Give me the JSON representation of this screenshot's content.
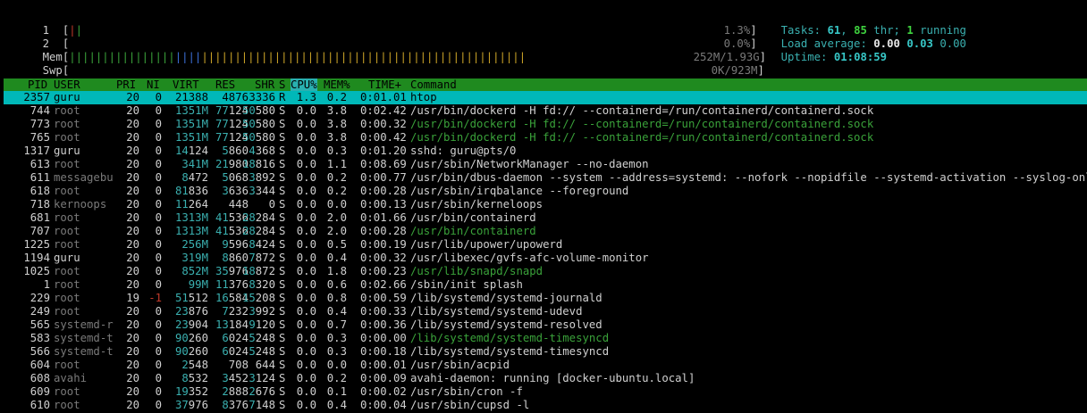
{
  "meters": {
    "cpu1": {
      "label": "1",
      "percent": "1.3%"
    },
    "cpu2": {
      "label": "2",
      "percent": "0.0%"
    },
    "mem": {
      "label": "Mem",
      "value": "252M/1.93G"
    },
    "swp": {
      "label": "Swp",
      "value": "0K/923M"
    }
  },
  "summary": {
    "tasks_label": "Tasks:",
    "tasks": "61",
    "threads": "85",
    "thr_label": "thr;",
    "running": "1",
    "running_label": "running",
    "load_label": "Load average:",
    "load1": "0.00",
    "load5": "0.03",
    "load15": "0.00",
    "uptime_label": "Uptime:",
    "uptime": "01:08:59"
  },
  "columns": [
    "PID",
    "USER",
    "PRI",
    "NI",
    "VIRT",
    "RES",
    "SHR",
    "S",
    "CPU%",
    "MEM%",
    "TIME+",
    "Command"
  ],
  "processes": [
    {
      "pid": "2357",
      "user": "guru",
      "pri": "20",
      "ni": "0",
      "virt": "21388",
      "res": "4876",
      "shr": "3336",
      "s": "R",
      "cpu": "1.3",
      "mem": "0.2",
      "time": "0:01.01",
      "cmd": "htop",
      "selected": true
    },
    {
      "pid": "744",
      "user": "root",
      "pri": "20",
      "ni": "0",
      "virt": "1351M",
      "res": "77124",
      "shr": "50580",
      "s": "S",
      "cpu": "0.0",
      "mem": "3.8",
      "time": "0:02.42",
      "cmd": "/usr/bin/dockerd -H fd:// --containerd=/run/containerd/containerd.sock"
    },
    {
      "pid": "773",
      "user": "root",
      "pri": "20",
      "ni": "0",
      "virt": "1351M",
      "res": "77124",
      "shr": "50580",
      "s": "S",
      "cpu": "0.0",
      "mem": "3.8",
      "time": "0:00.32",
      "cmd": "/usr/bin/dockerd -H fd:// --containerd=/run/containerd/containerd.sock",
      "thread": true
    },
    {
      "pid": "765",
      "user": "root",
      "pri": "20",
      "ni": "0",
      "virt": "1351M",
      "res": "77124",
      "shr": "50580",
      "s": "S",
      "cpu": "0.0",
      "mem": "3.8",
      "time": "0:00.42",
      "cmd": "/usr/bin/dockerd -H fd:// --containerd=/run/containerd/containerd.sock",
      "thread": true
    },
    {
      "pid": "1317",
      "user": "guru",
      "pri": "20",
      "ni": "0",
      "virt": "14124",
      "res": "5860",
      "shr": "4368",
      "s": "S",
      "cpu": "0.0",
      "mem": "0.3",
      "time": "0:01.20",
      "cmd": "sshd: guru@pts/0"
    },
    {
      "pid": "613",
      "user": "root",
      "pri": "20",
      "ni": "0",
      "virt": "341M",
      "res": "21980",
      "shr": "18816",
      "s": "S",
      "cpu": "0.0",
      "mem": "1.1",
      "time": "0:08.69",
      "cmd": "/usr/sbin/NetworkManager --no-daemon"
    },
    {
      "pid": "611",
      "user": "messagebu",
      "pri": "20",
      "ni": "0",
      "virt": "8472",
      "res": "5068",
      "shr": "3892",
      "s": "S",
      "cpu": "0.0",
      "mem": "0.2",
      "time": "0:00.77",
      "cmd": "/usr/bin/dbus-daemon --system --address=systemd: --nofork --nopidfile --systemd-activation --syslog-only"
    },
    {
      "pid": "618",
      "user": "root",
      "pri": "20",
      "ni": "0",
      "virt": "81836",
      "res": "3636",
      "shr": "3344",
      "s": "S",
      "cpu": "0.0",
      "mem": "0.2",
      "time": "0:00.28",
      "cmd": "/usr/sbin/irqbalance --foreground"
    },
    {
      "pid": "718",
      "user": "kernoops",
      "pri": "20",
      "ni": "0",
      "virt": "11264",
      "res": "448",
      "shr": "0",
      "s": "S",
      "cpu": "0.0",
      "mem": "0.0",
      "time": "0:00.13",
      "cmd": "/usr/sbin/kerneloops"
    },
    {
      "pid": "681",
      "user": "root",
      "pri": "20",
      "ni": "0",
      "virt": "1313M",
      "res": "41536",
      "shr": "28284",
      "s": "S",
      "cpu": "0.0",
      "mem": "2.0",
      "time": "0:01.66",
      "cmd": "/usr/bin/containerd"
    },
    {
      "pid": "707",
      "user": "root",
      "pri": "20",
      "ni": "0",
      "virt": "1313M",
      "res": "41536",
      "shr": "28284",
      "s": "S",
      "cpu": "0.0",
      "mem": "2.0",
      "time": "0:00.28",
      "cmd": "/usr/bin/containerd",
      "thread": true
    },
    {
      "pid": "1225",
      "user": "root",
      "pri": "20",
      "ni": "0",
      "virt": "256M",
      "res": "9596",
      "shr": "8424",
      "s": "S",
      "cpu": "0.0",
      "mem": "0.5",
      "time": "0:00.19",
      "cmd": "/usr/lib/upower/upowerd"
    },
    {
      "pid": "1194",
      "user": "guru",
      "pri": "20",
      "ni": "0",
      "virt": "319M",
      "res": "8860",
      "shr": "7872",
      "s": "S",
      "cpu": "0.0",
      "mem": "0.4",
      "time": "0:00.32",
      "cmd": "/usr/libexec/gvfs-afc-volume-monitor"
    },
    {
      "pid": "1025",
      "user": "root",
      "pri": "20",
      "ni": "0",
      "virt": "852M",
      "res": "35976",
      "shr": "18872",
      "s": "S",
      "cpu": "0.0",
      "mem": "1.8",
      "time": "0:00.23",
      "cmd": "/usr/lib/snapd/snapd",
      "thread": true
    },
    {
      "pid": "1",
      "user": "root",
      "pri": "20",
      "ni": "0",
      "virt": "99M",
      "res": "11376",
      "shr": "8320",
      "s": "S",
      "cpu": "0.0",
      "mem": "0.6",
      "time": "0:02.66",
      "cmd": "/sbin/init splash"
    },
    {
      "pid": "229",
      "user": "root",
      "pri": "19",
      "ni": "-1",
      "virt": "51512",
      "res": "16584",
      "shr": "15208",
      "s": "S",
      "cpu": "0.0",
      "mem": "0.8",
      "time": "0:00.59",
      "cmd": "/lib/systemd/systemd-journald"
    },
    {
      "pid": "249",
      "user": "root",
      "pri": "20",
      "ni": "0",
      "virt": "23876",
      "res": "7232",
      "shr": "3992",
      "s": "S",
      "cpu": "0.0",
      "mem": "0.4",
      "time": "0:00.33",
      "cmd": "/lib/systemd/systemd-udevd"
    },
    {
      "pid": "565",
      "user": "systemd-r",
      "pri": "20",
      "ni": "0",
      "virt": "23904",
      "res": "13184",
      "shr": "9120",
      "s": "S",
      "cpu": "0.0",
      "mem": "0.7",
      "time": "0:00.36",
      "cmd": "/lib/systemd/systemd-resolved"
    },
    {
      "pid": "583",
      "user": "systemd-t",
      "pri": "20",
      "ni": "0",
      "virt": "90260",
      "res": "6024",
      "shr": "5248",
      "s": "S",
      "cpu": "0.0",
      "mem": "0.3",
      "time": "0:00.00",
      "cmd": "/lib/systemd/systemd-timesyncd",
      "thread": true
    },
    {
      "pid": "566",
      "user": "systemd-t",
      "pri": "20",
      "ni": "0",
      "virt": "90260",
      "res": "6024",
      "shr": "5248",
      "s": "S",
      "cpu": "0.0",
      "mem": "0.3",
      "time": "0:00.18",
      "cmd": "/lib/systemd/systemd-timesyncd"
    },
    {
      "pid": "604",
      "user": "root",
      "pri": "20",
      "ni": "0",
      "virt": "2548",
      "res": "708",
      "shr": "644",
      "s": "S",
      "cpu": "0.0",
      "mem": "0.0",
      "time": "0:00.01",
      "cmd": "/usr/sbin/acpid"
    },
    {
      "pid": "608",
      "user": "avahi",
      "pri": "20",
      "ni": "0",
      "virt": "8532",
      "res": "3452",
      "shr": "3124",
      "s": "S",
      "cpu": "0.0",
      "mem": "0.2",
      "time": "0:00.09",
      "cmd": "avahi-daemon: running [docker-ubuntu.local]"
    },
    {
      "pid": "609",
      "user": "root",
      "pri": "20",
      "ni": "0",
      "virt": "19352",
      "res": "2888",
      "shr": "2676",
      "s": "S",
      "cpu": "0.0",
      "mem": "0.1",
      "time": "0:00.02",
      "cmd": "/usr/sbin/cron -f"
    },
    {
      "pid": "610",
      "user": "root",
      "pri": "20",
      "ni": "0",
      "virt": "37976",
      "res": "8376",
      "shr": "7148",
      "s": "S",
      "cpu": "0.0",
      "mem": "0.4",
      "time": "0:00.04",
      "cmd": "/usr/sbin/cupsd -l"
    }
  ],
  "colors": {
    "header_bg": "#1f8a1f",
    "selected_bg": "#00b8b8",
    "thread_cmd": "#3aa23a",
    "cyan": "#3ab0b0"
  }
}
